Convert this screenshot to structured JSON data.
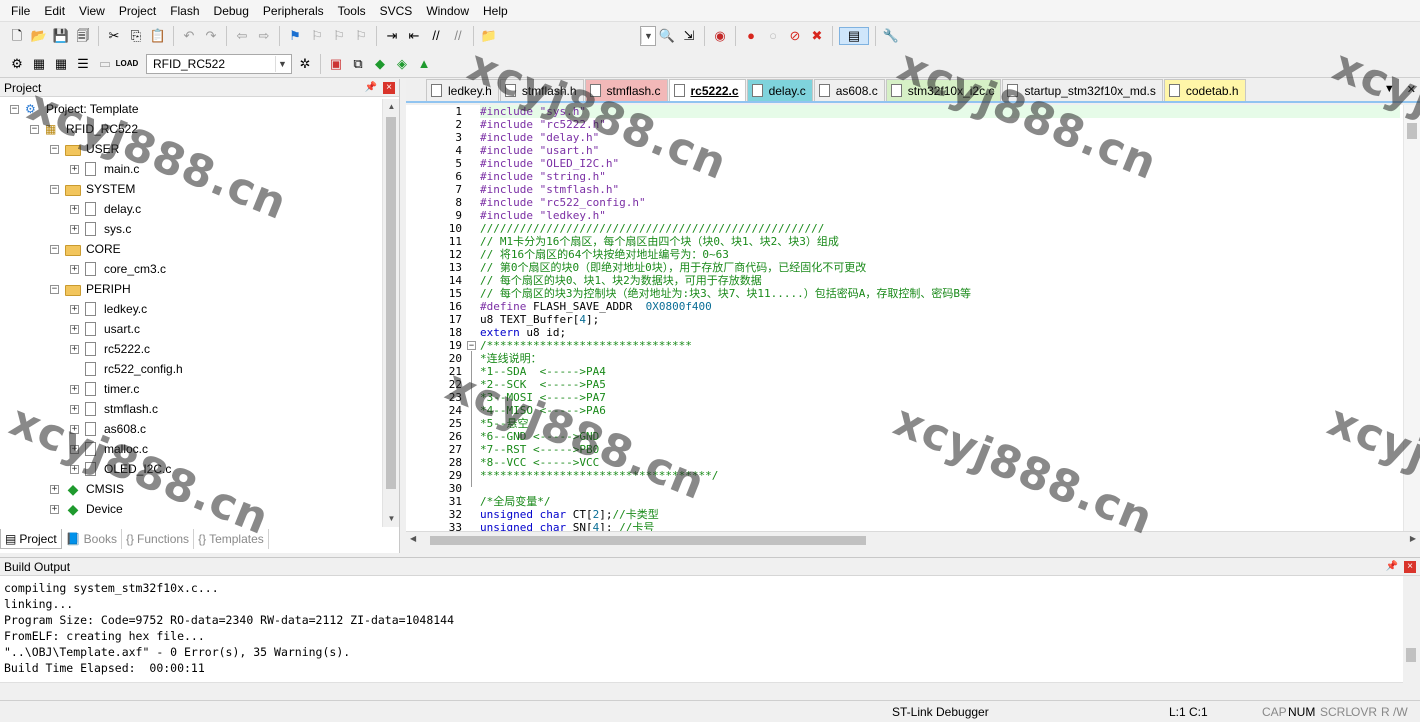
{
  "menu": [
    "File",
    "Edit",
    "View",
    "Project",
    "Flash",
    "Debug",
    "Peripherals",
    "Tools",
    "SVCS",
    "Window",
    "Help"
  ],
  "toolbar": {
    "target": "RFID_RC522"
  },
  "project_panel": {
    "title": "Project",
    "tree": [
      {
        "label": "Project: Template",
        "type": "root"
      },
      {
        "label": "RFID_RC522",
        "type": "target"
      },
      {
        "label": "USER",
        "type": "group"
      },
      {
        "label": "main.c",
        "type": "file"
      },
      {
        "label": "SYSTEM",
        "type": "group"
      },
      {
        "label": "delay.c",
        "type": "file"
      },
      {
        "label": "sys.c",
        "type": "file"
      },
      {
        "label": "CORE",
        "type": "group"
      },
      {
        "label": "core_cm3.c",
        "type": "file"
      },
      {
        "label": "PERIPH",
        "type": "group"
      },
      {
        "label": "ledkey.c",
        "type": "file"
      },
      {
        "label": "usart.c",
        "type": "file"
      },
      {
        "label": "rc5222.c",
        "type": "file"
      },
      {
        "label": "rc522_config.h",
        "type": "file"
      },
      {
        "label": "timer.c",
        "type": "file"
      },
      {
        "label": "stmflash.c",
        "type": "file"
      },
      {
        "label": "as608.c",
        "type": "file"
      },
      {
        "label": "malloc.c",
        "type": "file"
      },
      {
        "label": "OLED_I2C.c",
        "type": "file"
      },
      {
        "label": "CMSIS",
        "type": "component"
      },
      {
        "label": "Device",
        "type": "component"
      }
    ],
    "tabs": [
      "Project",
      "Books",
      "Functions",
      "Templates"
    ]
  },
  "editor": {
    "tabs": [
      {
        "label": "ledkey.h",
        "color": "#efefef"
      },
      {
        "label": "stmflash.h",
        "color": "#efefef"
      },
      {
        "label": "stmflash.c",
        "color": "#f2b8b8"
      },
      {
        "label": "rc5222.c",
        "color": "#ffffff",
        "active": true
      },
      {
        "label": "delay.c",
        "color": "#7fd3dc"
      },
      {
        "label": "as608.c",
        "color": "#efefef"
      },
      {
        "label": "stm32f10x_i2c.c",
        "color": "#d6f0c6"
      },
      {
        "label": "startup_stm32f10x_md.s",
        "color": "#efefef"
      },
      {
        "label": "codetab.h",
        "color": "#fff6a8"
      }
    ],
    "lines": [
      [
        [
          "pp",
          "#include "
        ],
        [
          "str",
          "\"sys.h\""
        ]
      ],
      [
        [
          "pp",
          "#include "
        ],
        [
          "str",
          "\"rc5222.h\""
        ]
      ],
      [
        [
          "pp",
          "#include "
        ],
        [
          "str",
          "\"delay.h\""
        ]
      ],
      [
        [
          "pp",
          "#include "
        ],
        [
          "str",
          "\"usart.h\""
        ]
      ],
      [
        [
          "pp",
          "#include "
        ],
        [
          "str",
          "\"OLED_I2C.h\""
        ]
      ],
      [
        [
          "pp",
          "#include "
        ],
        [
          "str",
          "\"string.h\""
        ]
      ],
      [
        [
          "pp",
          "#include "
        ],
        [
          "str",
          "\"stmflash.h\""
        ]
      ],
      [
        [
          "pp",
          "#include "
        ],
        [
          "str",
          "\"rc522_config.h\""
        ]
      ],
      [
        [
          "pp",
          "#include "
        ],
        [
          "str",
          "\"ledkey.h\""
        ]
      ],
      [
        [
          "cm",
          "////////////////////////////////////////////////////"
        ]
      ],
      [
        [
          "cm",
          "// M1卡分为16个扇区，每个扇区由四个块（块0、块1、块2、块3）组成"
        ]
      ],
      [
        [
          "cm",
          "// 将16个扇区的64个块按绝对地址编号为：0~63"
        ]
      ],
      [
        [
          "cm",
          "// 第0个扇区的块0（即绝对地址0块），用于存放厂商代码，已经固化不可更改"
        ]
      ],
      [
        [
          "cm",
          "// 每个扇区的块0、块1、块2为数据块，可用于存放数据"
        ]
      ],
      [
        [
          "cm",
          "// 每个扇区的块3为控制块（绝对地址为:块3、块7、块11.....）包括密码A，存取控制、密码B等"
        ]
      ],
      [
        [
          "pp",
          "#define "
        ],
        [
          "tx",
          "FLASH_SAVE_ADDR  "
        ],
        [
          "num",
          "0X0800f400"
        ]
      ],
      [
        [
          "tx",
          "u8 TEXT_Buffer["
        ],
        [
          "num",
          "4"
        ],
        [
          "tx",
          "];"
        ]
      ],
      [
        [
          "kw",
          "extern "
        ],
        [
          "tx",
          "u8 id;"
        ]
      ],
      [
        [
          "cm",
          "/*******************************"
        ]
      ],
      [
        [
          "cm",
          "*连线说明："
        ]
      ],
      [
        [
          "cm",
          "*1--SDA  <----->PA4"
        ]
      ],
      [
        [
          "cm",
          "*2--SCK  <----->PA5"
        ]
      ],
      [
        [
          "cm",
          "*3--MOSI <----->PA7"
        ]
      ],
      [
        [
          "cm",
          "*4--MISO <----->PA6"
        ]
      ],
      [
        [
          "cm",
          "*5--悬空"
        ]
      ],
      [
        [
          "cm",
          "*6--GND <----->GND"
        ]
      ],
      [
        [
          "cm",
          "*7--RST <----->PB0"
        ]
      ],
      [
        [
          "cm",
          "*8--VCC <----->VCC"
        ]
      ],
      [
        [
          "cm",
          "***********************************/"
        ]
      ],
      [
        [
          "tx",
          ""
        ]
      ],
      [
        [
          "cm",
          "/*全局变量*/"
        ]
      ],
      [
        [
          "kw",
          "unsigned char "
        ],
        [
          "tx",
          "CT["
        ],
        [
          "num",
          "2"
        ],
        [
          "tx",
          "];"
        ],
        [
          "cm",
          "//卡类型"
        ]
      ],
      [
        [
          "kw",
          "unsigned char "
        ],
        [
          "tx",
          "SN["
        ],
        [
          "num",
          "4"
        ],
        [
          "tx",
          "]; "
        ],
        [
          "cm",
          "//卡号"
        ]
      ]
    ]
  },
  "build_output": {
    "title": "Build Output",
    "lines": [
      "compiling system_stm32f10x.c...",
      "linking...",
      "Program Size: Code=9752 RO-data=2340 RW-data=2112 ZI-data=1048144",
      "FromELF: creating hex file...",
      "\"..\\OBJ\\Template.axf\" - 0 Error(s), 35 Warning(s).",
      "Build Time Elapsed:  00:00:11"
    ]
  },
  "status": {
    "debugger": "ST-Link Debugger",
    "position": "L:1 C:1",
    "cap": "CAP",
    "num": "NUM",
    "scrl": "SCRL",
    "ovr": "OVR",
    "rw": "R /W"
  },
  "watermark": "xcyj888.cn"
}
